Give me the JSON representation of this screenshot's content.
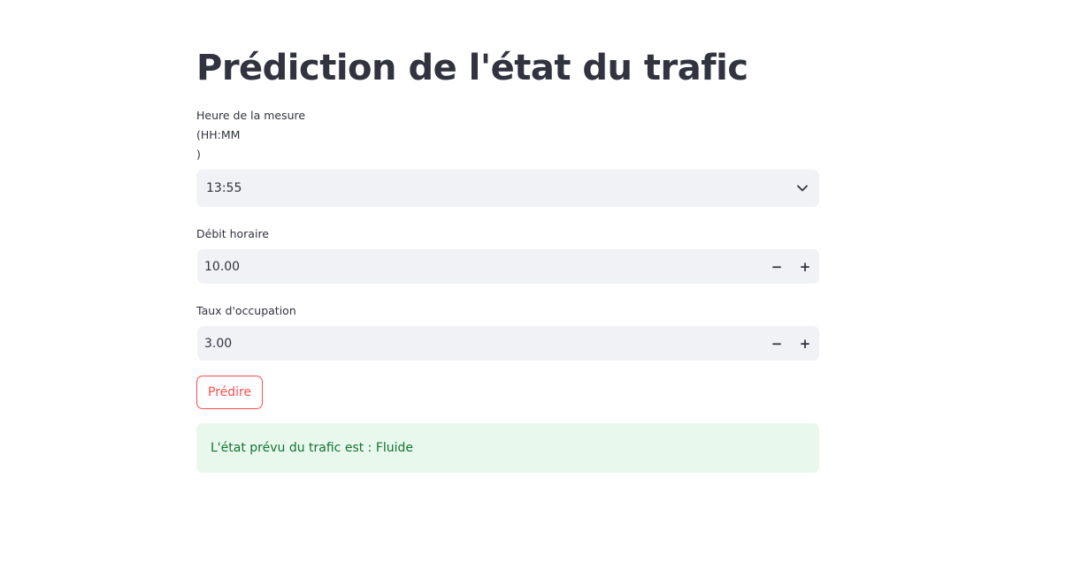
{
  "page": {
    "title": "Prédiction de l'état du trafic"
  },
  "time_select": {
    "label_line1": "Heure de la mesure (HH:MM",
    "label_line2": ")",
    "value": "13:55",
    "icon": "chevron-down-icon"
  },
  "flow_input": {
    "label": "Débit horaire",
    "value": "10.00",
    "minus_label": "−",
    "plus_label": "+"
  },
  "occupancy_input": {
    "label": "Taux d'occupation",
    "value": "3.00",
    "minus_label": "−",
    "plus_label": "+"
  },
  "predict_button": {
    "label": "Prédire"
  },
  "result": {
    "text": "L'état prévu du trafic est : Fluide"
  },
  "colors": {
    "text": "#31333f",
    "input_bg": "#f0f2f6",
    "accent": "#ff4b4b",
    "success_bg": "#e8f8ed",
    "success_text": "#177233"
  }
}
